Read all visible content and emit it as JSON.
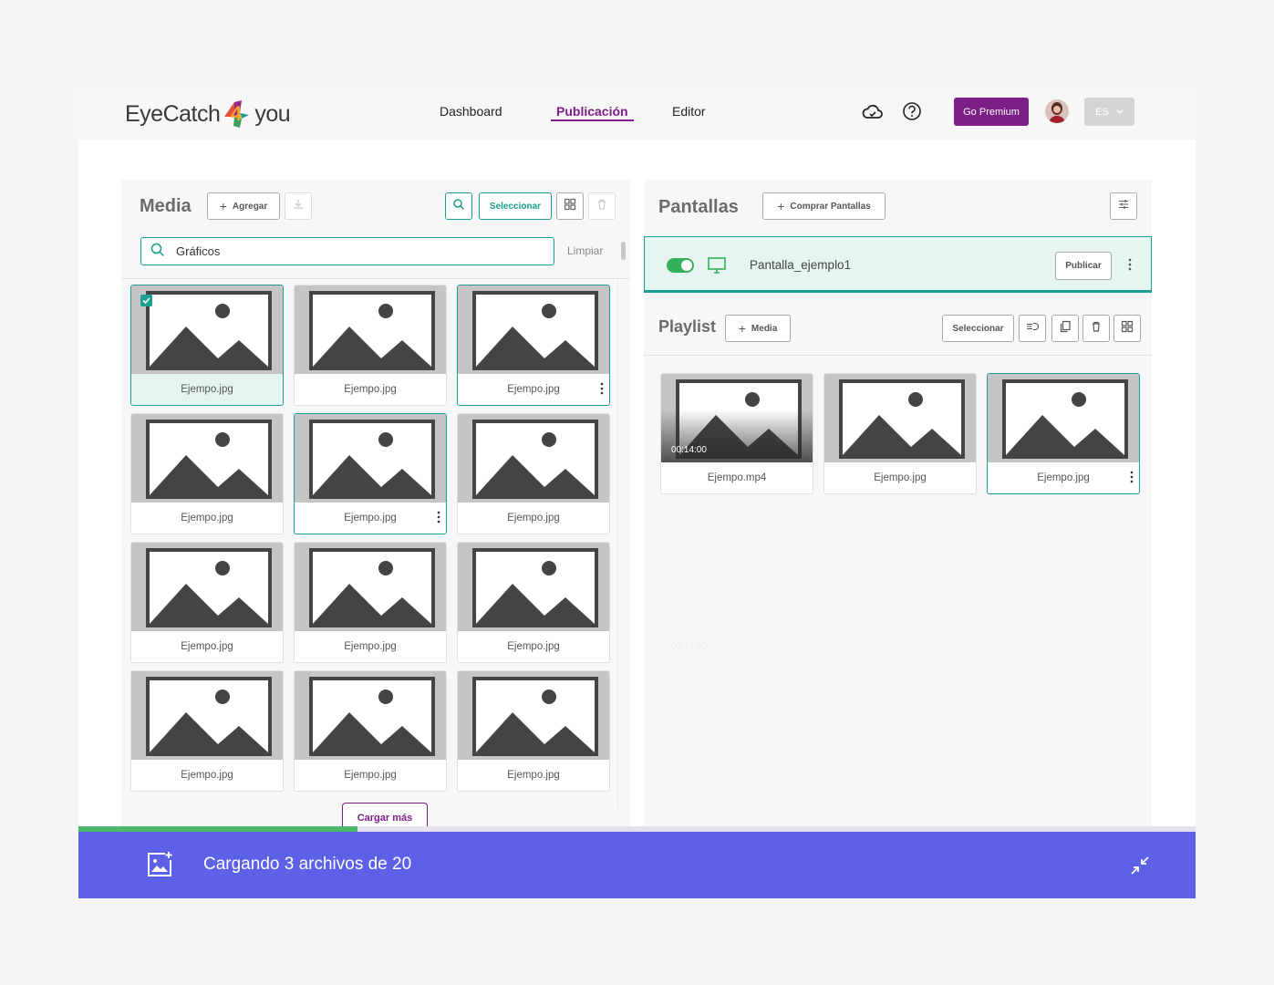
{
  "header": {
    "brand": {
      "left": "EyeCatch",
      "mid": "4",
      "right": "you"
    },
    "nav": [
      {
        "label": "Dashboard",
        "active": false
      },
      {
        "label": "Publicación",
        "active": true
      },
      {
        "label": "Editor",
        "active": false
      }
    ],
    "premium_label": "Go Premium",
    "lang": "ES",
    "accent": "#7b1e85"
  },
  "media": {
    "title": "Media",
    "add_label": "Agregar",
    "select_label": "Seleccionar",
    "search_value": "Gráficos",
    "clear_label": "Limpiar",
    "items": [
      {
        "name": "Ejempo.jpg"
      },
      {
        "name": "Ejempo.jpg"
      },
      {
        "name": "Ejempo.jpg"
      },
      {
        "name": "Ejempo.jpg"
      },
      {
        "name": "Ejempo.jpg"
      },
      {
        "name": "Ejempo.jpg"
      },
      {
        "name": "Ejempo.jpg"
      },
      {
        "name": "Ejempo.jpg"
      },
      {
        "name": "Ejempo.jpg"
      },
      {
        "name": "Ejempo.jpg"
      },
      {
        "name": "Ejempo.jpg"
      },
      {
        "name": "Ejempo.jpg"
      }
    ],
    "load_more_label": "Cargar más"
  },
  "screens": {
    "title": "Pantallas",
    "buy_label": "Comprar Pantallas",
    "screen_name": "Pantalla_ejemplo1",
    "publish_label": "Publicar",
    "playlist_title": "Playlist",
    "playlist_add_label": "Media",
    "playlist_select_label": "Seleccionar",
    "playlist_items": [
      {
        "name": "Ejempo.mp4",
        "time": "00:14:00"
      },
      {
        "name": "Ejempo.jpg"
      },
      {
        "name": "Ejempo.jpg"
      }
    ],
    "ghost_time": "00:14:00"
  },
  "upload": {
    "status": "Cargando 3 archivos de 20",
    "progress": 0.25,
    "color": "#5c61e8"
  }
}
